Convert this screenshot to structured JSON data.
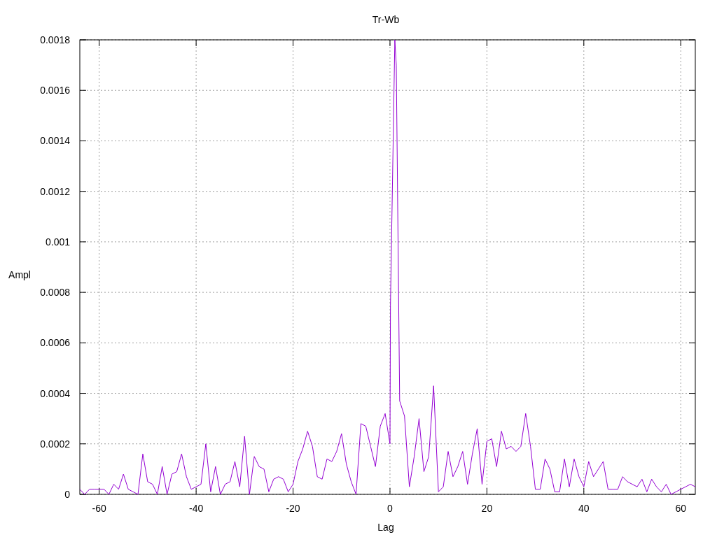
{
  "chart_data": {
    "type": "line",
    "title": "Tr-Wb",
    "xlabel": "Lag",
    "ylabel": "Ampl",
    "grid": true,
    "xlim": [
      -64,
      63
    ],
    "ylim": [
      0,
      0.0018
    ],
    "xticks": [
      -60,
      -40,
      -20,
      0,
      20,
      40,
      60
    ],
    "yticks": [
      0,
      0.0002,
      0.0004,
      0.0006,
      0.0008,
      0.001,
      0.0012,
      0.0014,
      0.0016,
      0.0018
    ],
    "x": [
      -64,
      -63,
      -62,
      -61,
      -60,
      -59,
      -58,
      -57,
      -56,
      -55,
      -54,
      -53,
      -52,
      -51,
      -50,
      -49,
      -48,
      -47,
      -46,
      -45,
      -44,
      -43,
      -42,
      -41,
      -40,
      -39,
      -38,
      -37,
      -36,
      -35,
      -34,
      -33,
      -32,
      -31,
      -30,
      -29,
      -28,
      -27,
      -26,
      -25,
      -24,
      -23,
      -22,
      -21,
      -20,
      -19,
      -18,
      -17,
      -16,
      -15,
      -14,
      -13,
      -12,
      -11,
      -10,
      -9,
      -8,
      -7,
      -6,
      -5,
      -4,
      -3,
      -2,
      -1,
      0,
      0.1,
      1,
      1.3,
      2,
      3,
      4,
      5,
      6,
      7,
      8,
      9,
      10,
      11,
      12,
      13,
      14,
      15,
      16,
      17,
      18,
      19,
      20,
      21,
      22,
      23,
      24,
      25,
      26,
      27,
      28,
      29,
      30,
      31,
      32,
      33,
      34,
      35,
      36,
      37,
      38,
      39,
      40,
      41,
      42,
      43,
      44,
      45,
      46,
      47,
      48,
      49,
      50,
      51,
      52,
      53,
      54,
      55,
      56,
      57,
      58,
      59,
      60,
      61,
      62,
      63
    ],
    "series": [
      {
        "color": "#9400d3",
        "values": [
          2e-05,
          0,
          2e-05,
          2e-05,
          2e-05,
          2e-05,
          0,
          4e-05,
          2e-05,
          8e-05,
          2e-05,
          1e-05,
          0,
          0.00016,
          5e-05,
          4e-05,
          0,
          0.00011,
          0,
          8e-05,
          9e-05,
          0.00016,
          7e-05,
          2e-05,
          3e-05,
          4e-05,
          0.0002,
          1e-05,
          0.00011,
          0,
          4e-05,
          5e-05,
          0.00013,
          3e-05,
          0.00023,
          0,
          0.00015,
          0.00011,
          0.0001,
          1e-05,
          6e-05,
          7e-05,
          6e-05,
          1e-05,
          4e-05,
          0.00013,
          0.00018,
          0.00025,
          0.00019,
          7e-05,
          6e-05,
          0.00014,
          0.00013,
          0.00017,
          0.00024,
          0.00012,
          5e-05,
          0,
          0.00028,
          0.00027,
          0.00019,
          0.00011,
          0.00027,
          0.00032,
          0.0002,
          0.00075,
          0.0018,
          0.0017,
          0.00037,
          0.00031,
          3e-05,
          0.00015,
          0.0003,
          9e-05,
          0.00015,
          0.00043,
          1e-05,
          3e-05,
          0.00017,
          7e-05,
          0.00011,
          0.00017,
          4e-05,
          0.00016,
          0.00026,
          4e-05,
          0.00021,
          0.00022,
          0.00011,
          0.00025,
          0.00018,
          0.00019,
          0.00017,
          0.00019,
          0.00032,
          0.00019,
          2e-05,
          2e-05,
          0.00014,
          0.0001,
          1e-05,
          1e-05,
          0.00014,
          3e-05,
          0.00014,
          7e-05,
          3e-05,
          0.00013,
          7e-05,
          0.0001,
          0.00013,
          2e-05,
          2e-05,
          2e-05,
          7e-05,
          5e-05,
          4e-05,
          3e-05,
          6e-05,
          1e-05,
          6e-05,
          3e-05,
          1e-05,
          4e-05,
          0,
          1e-05,
          2e-05,
          3e-05,
          4e-05,
          3e-05
        ]
      }
    ]
  }
}
